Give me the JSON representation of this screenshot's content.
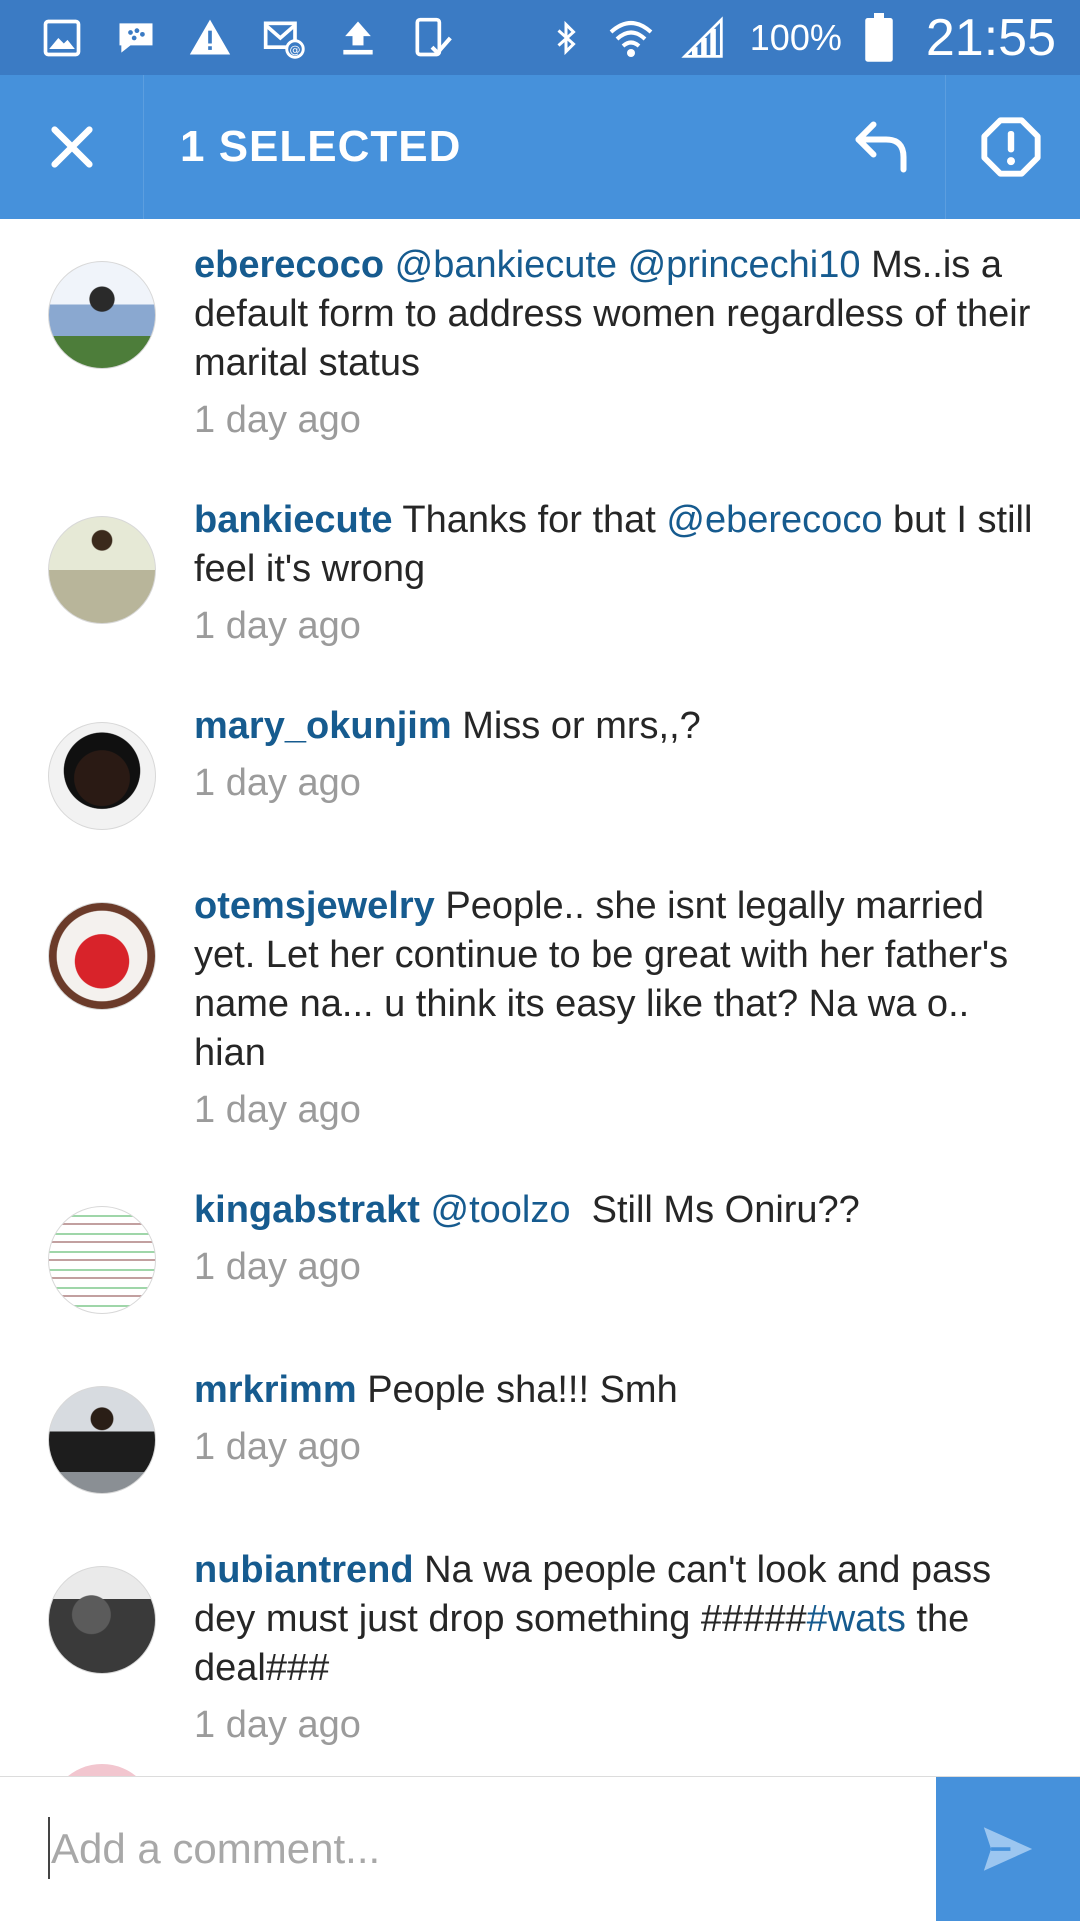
{
  "status_bar": {
    "battery_percent": "100%",
    "time": "21:55"
  },
  "app_bar": {
    "title": "1 SELECTED"
  },
  "comments": [
    {
      "username": "eberecoco",
      "mentions": "@bankiecute @princechi10",
      "text": " Ms..is a default form to address women regardless of their marital status",
      "time": "1 day ago"
    },
    {
      "username": "bankiecute",
      "text_before": " Thanks for that ",
      "mention": "@eberecoco",
      "text_after": " but I still feel it's wrong",
      "time": "1 day ago"
    },
    {
      "username": "mary_okunjim",
      "text": " Miss or mrs,,?",
      "time": "1 day ago"
    },
    {
      "username": "otemsjewelry",
      "text": " People.. she isnt legally married yet. Let her continue to be great with her father's name na... u think its easy like that? Na wa o.. hian",
      "time": "1 day ago"
    },
    {
      "username": "kingabstrakt",
      "mention": "@toolzo",
      "text": "  Still Ms Oniru??",
      "time": "1 day ago"
    },
    {
      "username": "mrkrimm",
      "text": " People sha!!! Smh",
      "time": "1 day ago"
    },
    {
      "username": "nubiantrend",
      "text_before": " Na wa people can't look and pass dey must just drop something #####",
      "hashtag": "#wats",
      "text_after": " the deal###",
      "time": "1 day ago"
    }
  ],
  "composer": {
    "placeholder": "Add a comment..."
  },
  "colors": {
    "status_bar": "#3b7bc4",
    "app_bar": "#4691db",
    "username": "#165b8f",
    "timestamp": "#9b9b9b"
  }
}
